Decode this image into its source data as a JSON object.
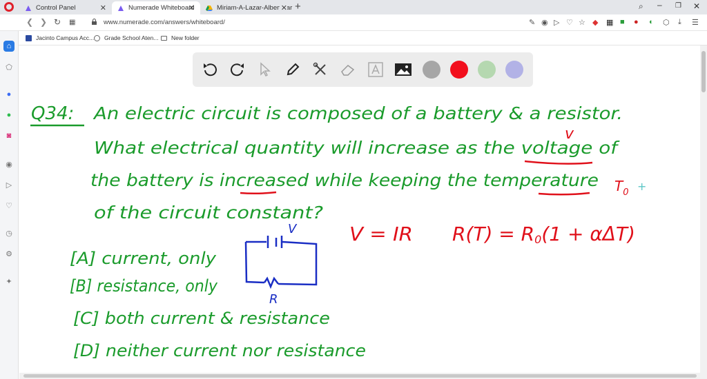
{
  "tabs": [
    {
      "label": "Control Panel"
    },
    {
      "label": "Numerade Whiteboard"
    },
    {
      "label": "Miriam-A-Lazar-Albert-Tar"
    }
  ],
  "address": {
    "url": "www.numerade.com/answers/whiteboard/"
  },
  "bookmarks": [
    {
      "label": "Jacinto Campus Acc..."
    },
    {
      "label": "Grade School Aten..."
    },
    {
      "label": "New folder"
    }
  ],
  "toolbar": {
    "colors": {
      "gray": "#a6a6a6",
      "red": "#f20f1d",
      "green": "#b5d8b0",
      "purple": "#b2b2e6"
    }
  },
  "whiteboard": {
    "question_label": "Q34:",
    "question_lines": [
      "An electric circuit is composed of a battery & a resistor.",
      "What electrical quantity will increase as the voltage of",
      "the battery is increased while keeping the temperature",
      "of the circuit constant?"
    ],
    "temp_symbol": "T",
    "temp_sub": "0",
    "voltage_check": "v",
    "options": [
      "[A] current, only",
      "[B] resistance, only",
      "[C] both current & resistance",
      "[D] neither current nor resistance"
    ],
    "battery_label": "V",
    "resistor_label": "R",
    "ohms_law": "V = IR",
    "resistance_formula": "R(T) = R",
    "resistance_formula_sub": "0",
    "resistance_formula_tail": "(1 + αΔT)"
  }
}
